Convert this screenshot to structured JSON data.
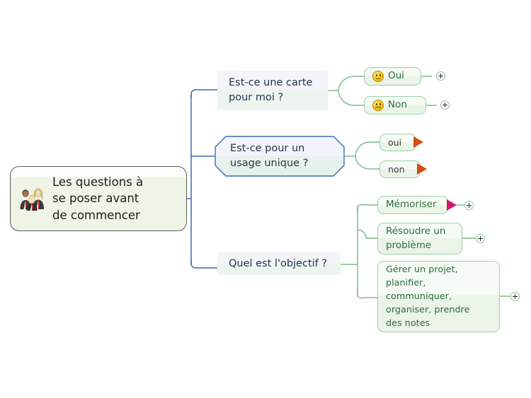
{
  "map": {
    "root": {
      "label": "Les questions à\nse poser avant\nde commencer",
      "icon": "people-group-icon",
      "border_color": "#5c5c52",
      "fill_color": "#eef4e6"
    },
    "branches": [
      {
        "id": "carte",
        "label": "Est-ce une carte\npour moi ?",
        "shape": "tile",
        "children": [
          {
            "id": "oui-carte",
            "label": "Oui",
            "icon": "smiley-happy-icon",
            "expand": "+"
          },
          {
            "id": "non-carte",
            "label": "Non",
            "icon": "smiley-neutral-icon",
            "expand": "+"
          }
        ]
      },
      {
        "id": "usage",
        "label": "Est-ce pour un\nusage unique ?",
        "shape": "hexagon",
        "border_color": "#3b6bb0",
        "children": [
          {
            "id": "oui-usage",
            "label": "oui",
            "marker": "arrow-orange",
            "marker_color": "#d1500f"
          },
          {
            "id": "non-usage",
            "label": "non",
            "marker": "arrow-orange",
            "marker_color": "#d1500f"
          }
        ]
      },
      {
        "id": "objectif",
        "label": "Quel est l'objectif ?",
        "shape": "tile",
        "children": [
          {
            "id": "memoriser",
            "label": "Mémoriser",
            "marker": "arrow-crimson",
            "marker_color": "#d6156b",
            "expand": "+"
          },
          {
            "id": "resoudre",
            "label": "Résoudre un\nproblème",
            "expand": "+"
          },
          {
            "id": "gerer",
            "label": "Gérer un projet,\nplanifier,\ncommuniquer,\norganiser, prendre\ndes notes",
            "expand": "+"
          }
        ]
      }
    ],
    "colors": {
      "trunk_line": "#3b6bb0",
      "branch_line": "#7fba8c",
      "leaf_border": "#9ecfa6",
      "leaf_text": "#2f6b3d",
      "tile_text": "#1f3348"
    }
  }
}
